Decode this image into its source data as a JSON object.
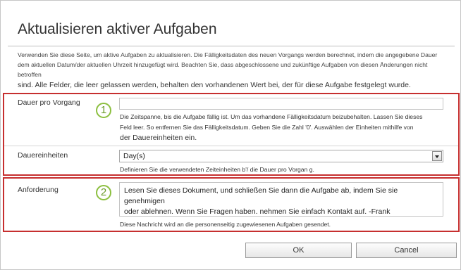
{
  "dialog": {
    "title": "Aktualisieren aktiver Aufgaben",
    "description": [
      "Verwenden Sie diese Seite, um aktive Aufgaben zu aktualisieren. Die Fälligkeitsdaten des neuen Vorgangs werden berechnet, indem die angegebene Dauer",
      "dem aktuellen Datum/der aktuellen Uhrzeit hinzugefügt wird. Beachten Sie, dass abgeschlossene und zukünftige Aufgaben von diesen Änderungen nicht betroffen",
      "sind. Alle Felder, die leer gelassen werden, behalten den vorhandenen Wert bei, der für diese Aufgabe festgelegt wurde."
    ]
  },
  "callouts": {
    "one": "1",
    "two": "2"
  },
  "fields": {
    "duration": {
      "label": "Dauer pro Vorgang",
      "value": "",
      "hint_lines": [
        "Die Zeitspanne, bis die Aufgabe fällig ist. Um das vorhandene Fälligkeitsdatum beizubehalten. Lassen Sie dieses",
        "Feld leer. So entfernen Sie das Fälligkeitsdatum. Geben Sie die Zahl   '0'. Auswählen der Einheiten mithilfe von",
        "der Dauereinheiten ein."
      ]
    },
    "units": {
      "label": "Dauereinheiten",
      "selected": "Day(s)",
      "hint": "Definieren Sie die verwendeten Zeiteinheiten b'/ die Dauer pro Vorgan g."
    },
    "request": {
      "label": "Anforderung",
      "value_lines": [
        "Lesen Sie dieses Dokument, und schließen Sie dann die Aufgabe ab, indem Sie sie genehmigen",
        "oder ablehnen. Wenn Sie Fragen haben. nehmen Sie einfach Kontakt auf. -Frank"
      ],
      "hint": "Diese Nachricht wird an die personenseitig zugewiesenen Aufgaben gesendet."
    }
  },
  "buttons": {
    "ok": "OK",
    "cancel": "Cancel"
  },
  "colors": {
    "highlight_border": "#c62f2f",
    "callout": "#8cbf3f"
  },
  "icons": {
    "select_arrow": "chevron-down-icon"
  }
}
